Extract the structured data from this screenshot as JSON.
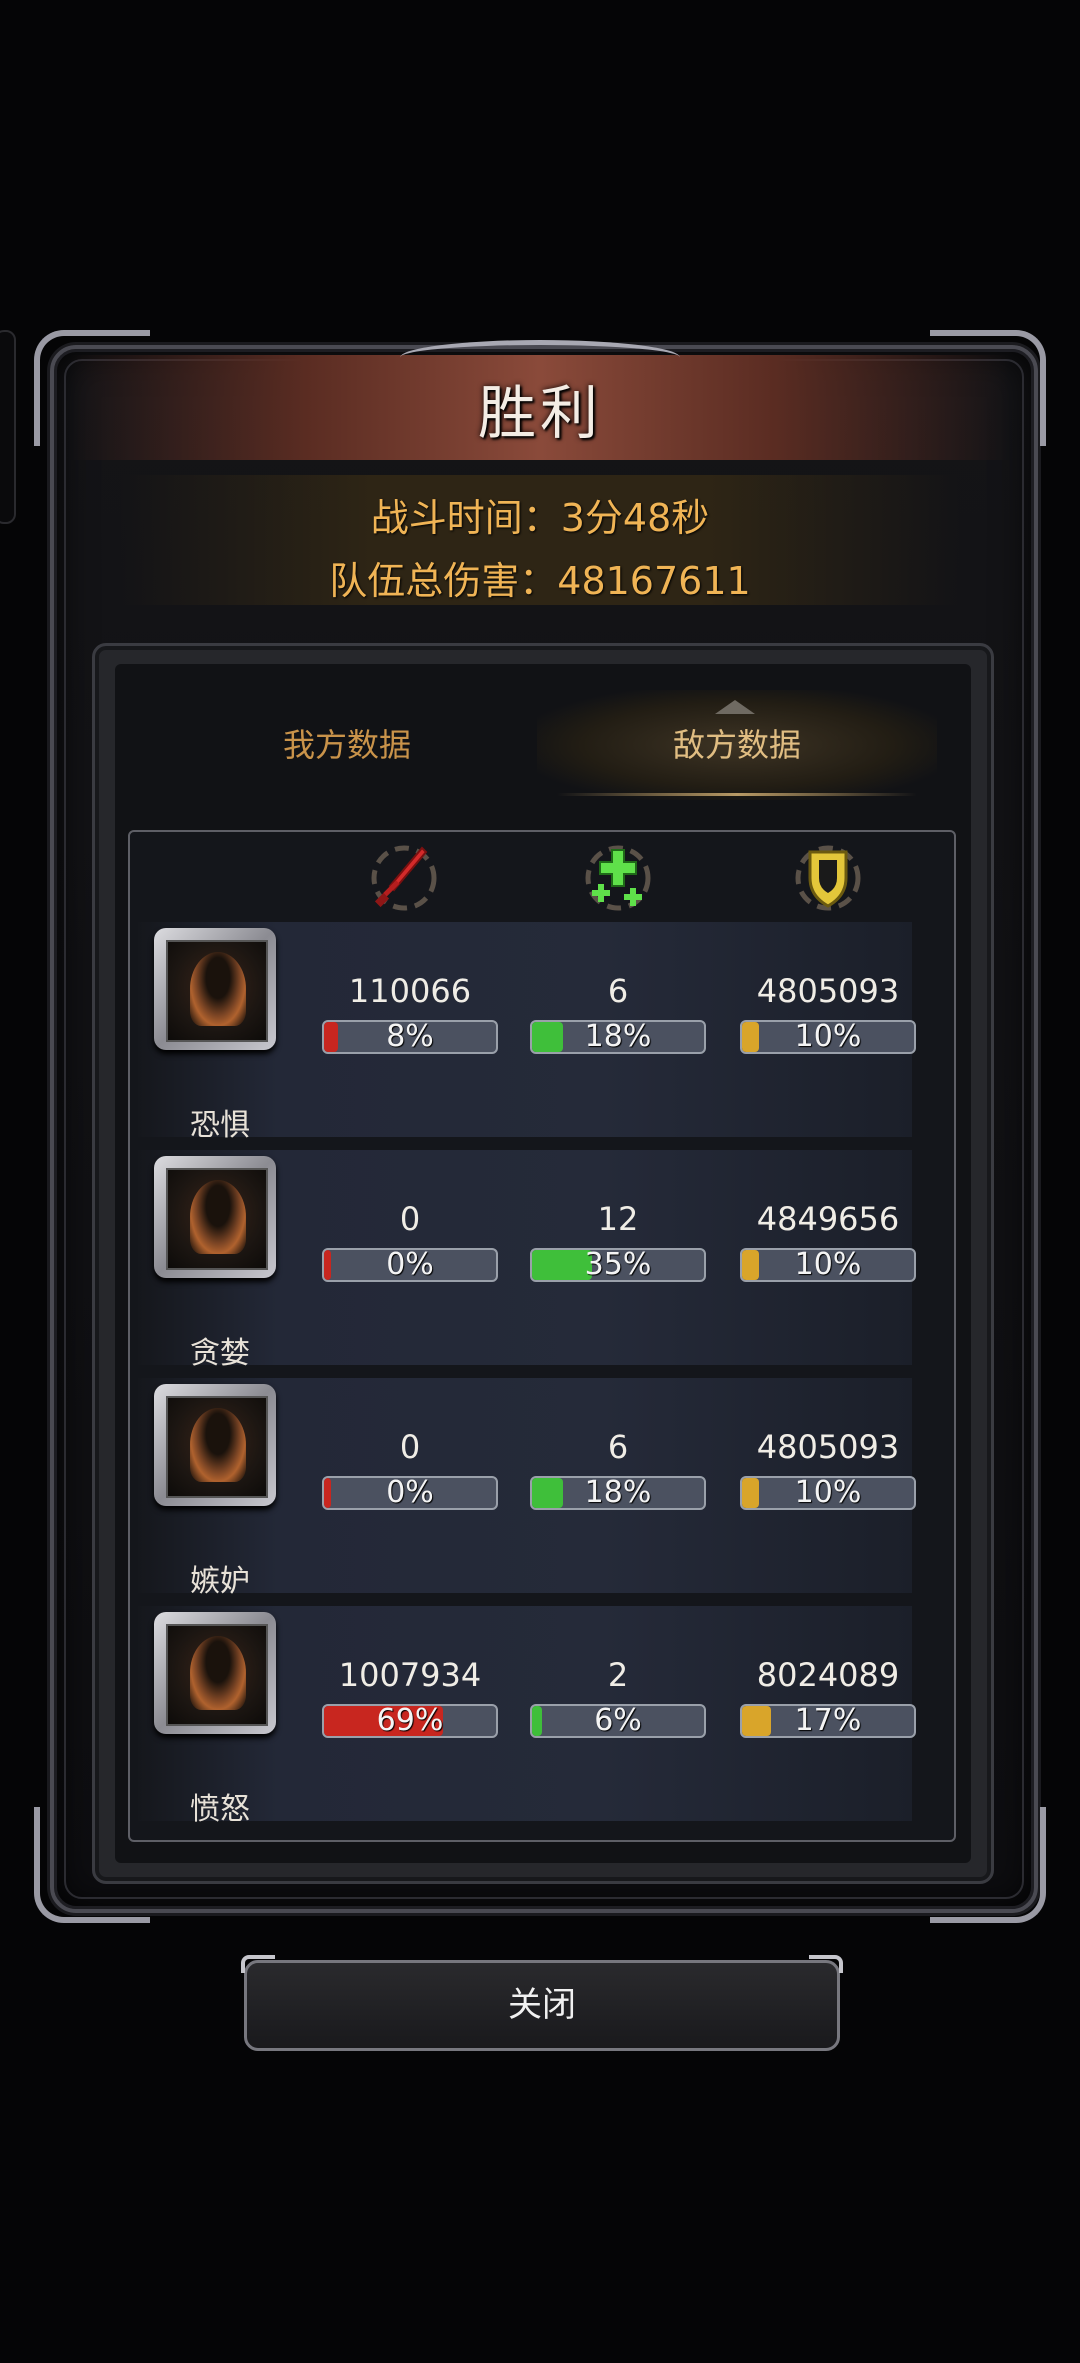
{
  "title": "胜利",
  "summary": {
    "battle_time": "战斗时间：3分48秒",
    "team_damage": "队伍总伤害：48167611"
  },
  "tabs": [
    {
      "label": "我方数据",
      "active": false
    },
    {
      "label": "敌方数据",
      "active": true
    }
  ],
  "columns": [
    {
      "icon": "sword-icon",
      "color": "#d42a2a"
    },
    {
      "icon": "heal-cross-icon",
      "color": "#5fe04a"
    },
    {
      "icon": "shield-icon",
      "color": "#e3c63a"
    }
  ],
  "rows": [
    {
      "name": "恐惧",
      "damage": "110066",
      "damage_pct": "8%",
      "damage_frac": 0.08,
      "heal": "6",
      "heal_pct": "18%",
      "heal_frac": 0.18,
      "taken": "4805093",
      "taken_pct": "10%",
      "taken_frac": 0.1
    },
    {
      "name": "贪婪",
      "damage": "0",
      "damage_pct": "0%",
      "damage_frac": 0,
      "heal": "12",
      "heal_pct": "35%",
      "heal_frac": 0.35,
      "taken": "4849656",
      "taken_pct": "10%",
      "taken_frac": 0.1
    },
    {
      "name": "嫉妒",
      "damage": "0",
      "damage_pct": "0%",
      "damage_frac": 0,
      "heal": "6",
      "heal_pct": "18%",
      "heal_frac": 0.18,
      "taken": "4805093",
      "taken_pct": "10%",
      "taken_frac": 0.1
    },
    {
      "name": "愤怒",
      "damage": "1007934",
      "damage_pct": "69%",
      "damage_frac": 0.69,
      "heal": "2",
      "heal_pct": "6%",
      "heal_frac": 0.06,
      "taken": "8024089",
      "taken_pct": "17%",
      "taken_frac": 0.17
    }
  ],
  "close_label": "关闭",
  "colors": {
    "damage_bar": "#c8261f",
    "heal_bar": "#3fbf3a",
    "taken_bar": "#d9a52a"
  }
}
